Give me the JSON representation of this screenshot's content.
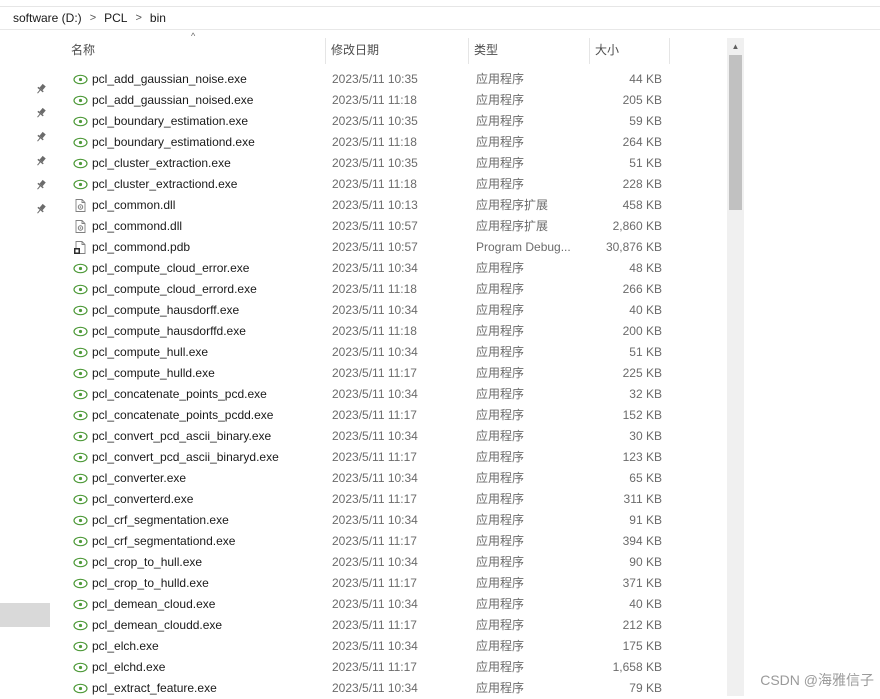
{
  "breadcrumb": [
    "software (D:)",
    "PCL",
    "bin"
  ],
  "breadcrumb_separator": ">",
  "columns": {
    "name": "名称",
    "date": "修改日期",
    "type": "类型",
    "size": "大小"
  },
  "sort_indicator": "^",
  "scrollbar": {
    "up_arrow": "▲",
    "position": 0.0
  },
  "watermark": "CSDN @海雅信子",
  "icons": {
    "exe": "application-icon",
    "dll": "dll-file-icon",
    "pdb": "pdb-file-icon",
    "pin": "pin-icon"
  },
  "files": [
    {
      "name": "pcl_add_gaussian_noise.exe",
      "date": "2023/5/11 10:35",
      "type": "应用程序",
      "size": "44 KB",
      "icon": "exe"
    },
    {
      "name": "pcl_add_gaussian_noised.exe",
      "date": "2023/5/11 11:18",
      "type": "应用程序",
      "size": "205 KB",
      "icon": "exe"
    },
    {
      "name": "pcl_boundary_estimation.exe",
      "date": "2023/5/11 10:35",
      "type": "应用程序",
      "size": "59 KB",
      "icon": "exe"
    },
    {
      "name": "pcl_boundary_estimationd.exe",
      "date": "2023/5/11 11:18",
      "type": "应用程序",
      "size": "264 KB",
      "icon": "exe"
    },
    {
      "name": "pcl_cluster_extraction.exe",
      "date": "2023/5/11 10:35",
      "type": "应用程序",
      "size": "51 KB",
      "icon": "exe"
    },
    {
      "name": "pcl_cluster_extractiond.exe",
      "date": "2023/5/11 11:18",
      "type": "应用程序",
      "size": "228 KB",
      "icon": "exe"
    },
    {
      "name": "pcl_common.dll",
      "date": "2023/5/11 10:13",
      "type": "应用程序扩展",
      "size": "458 KB",
      "icon": "dll"
    },
    {
      "name": "pcl_commond.dll",
      "date": "2023/5/11 10:57",
      "type": "应用程序扩展",
      "size": "2,860 KB",
      "icon": "dll"
    },
    {
      "name": "pcl_commond.pdb",
      "date": "2023/5/11 10:57",
      "type": "Program Debug...",
      "size": "30,876 KB",
      "icon": "pdb"
    },
    {
      "name": "pcl_compute_cloud_error.exe",
      "date": "2023/5/11 10:34",
      "type": "应用程序",
      "size": "48 KB",
      "icon": "exe"
    },
    {
      "name": "pcl_compute_cloud_errord.exe",
      "date": "2023/5/11 11:18",
      "type": "应用程序",
      "size": "266 KB",
      "icon": "exe"
    },
    {
      "name": "pcl_compute_hausdorff.exe",
      "date": "2023/5/11 10:34",
      "type": "应用程序",
      "size": "40 KB",
      "icon": "exe"
    },
    {
      "name": "pcl_compute_hausdorffd.exe",
      "date": "2023/5/11 11:18",
      "type": "应用程序",
      "size": "200 KB",
      "icon": "exe"
    },
    {
      "name": "pcl_compute_hull.exe",
      "date": "2023/5/11 10:34",
      "type": "应用程序",
      "size": "51 KB",
      "icon": "exe"
    },
    {
      "name": "pcl_compute_hulld.exe",
      "date": "2023/5/11 11:17",
      "type": "应用程序",
      "size": "225 KB",
      "icon": "exe"
    },
    {
      "name": "pcl_concatenate_points_pcd.exe",
      "date": "2023/5/11 10:34",
      "type": "应用程序",
      "size": "32 KB",
      "icon": "exe"
    },
    {
      "name": "pcl_concatenate_points_pcdd.exe",
      "date": "2023/5/11 11:17",
      "type": "应用程序",
      "size": "152 KB",
      "icon": "exe"
    },
    {
      "name": "pcl_convert_pcd_ascii_binary.exe",
      "date": "2023/5/11 10:34",
      "type": "应用程序",
      "size": "30 KB",
      "icon": "exe"
    },
    {
      "name": "pcl_convert_pcd_ascii_binaryd.exe",
      "date": "2023/5/11 11:17",
      "type": "应用程序",
      "size": "123 KB",
      "icon": "exe"
    },
    {
      "name": "pcl_converter.exe",
      "date": "2023/5/11 10:34",
      "type": "应用程序",
      "size": "65 KB",
      "icon": "exe"
    },
    {
      "name": "pcl_converterd.exe",
      "date": "2023/5/11 11:17",
      "type": "应用程序",
      "size": "311 KB",
      "icon": "exe"
    },
    {
      "name": "pcl_crf_segmentation.exe",
      "date": "2023/5/11 10:34",
      "type": "应用程序",
      "size": "91 KB",
      "icon": "exe"
    },
    {
      "name": "pcl_crf_segmentationd.exe",
      "date": "2023/5/11 11:17",
      "type": "应用程序",
      "size": "394 KB",
      "icon": "exe"
    },
    {
      "name": "pcl_crop_to_hull.exe",
      "date": "2023/5/11 10:34",
      "type": "应用程序",
      "size": "90 KB",
      "icon": "exe"
    },
    {
      "name": "pcl_crop_to_hulld.exe",
      "date": "2023/5/11 11:17",
      "type": "应用程序",
      "size": "371 KB",
      "icon": "exe"
    },
    {
      "name": "pcl_demean_cloud.exe",
      "date": "2023/5/11 10:34",
      "type": "应用程序",
      "size": "40 KB",
      "icon": "exe"
    },
    {
      "name": "pcl_demean_cloudd.exe",
      "date": "2023/5/11 11:17",
      "type": "应用程序",
      "size": "212 KB",
      "icon": "exe"
    },
    {
      "name": "pcl_elch.exe",
      "date": "2023/5/11 10:34",
      "type": "应用程序",
      "size": "175 KB",
      "icon": "exe"
    },
    {
      "name": "pcl_elchd.exe",
      "date": "2023/5/11 11:17",
      "type": "应用程序",
      "size": "1,658 KB",
      "icon": "exe"
    },
    {
      "name": "pcl_extract_feature.exe",
      "date": "2023/5/11 10:34",
      "type": "应用程序",
      "size": "79 KB",
      "icon": "exe"
    }
  ]
}
